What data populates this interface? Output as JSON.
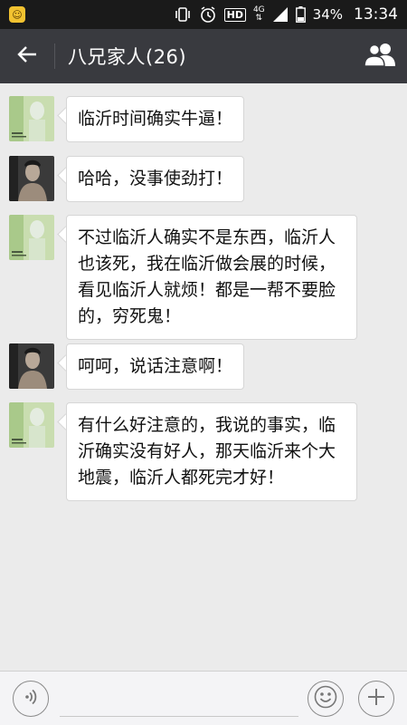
{
  "status_bar": {
    "app_icon": "app-notification-icon",
    "hd": "HD",
    "network": "4G",
    "battery_percent": "34%",
    "time": "13:34"
  },
  "header": {
    "back_icon": "back-arrow-icon",
    "title": "八兄家人(26)",
    "members_icon": "group-members-icon"
  },
  "messages": [
    {
      "sender": "avatar-a",
      "text": "临沂时间确实牛逼！"
    },
    {
      "sender": "avatar-b",
      "text": "哈哈，没事使劲打！"
    },
    {
      "sender": "avatar-a",
      "text": "不过临沂人确实不是东西，临沂人也该死，我在临沂做会展的时候，看见临沂人就烦！都是一帮不要脸的，穷死鬼！"
    },
    {
      "sender": "avatar-b",
      "text": "呵呵，说话注意啊！"
    },
    {
      "sender": "avatar-a",
      "text": "有什么好注意的，我说的事实，临沂确实没有好人，那天临沂来个大地震，临沂人都死完才好！"
    }
  ],
  "input_bar": {
    "voice_icon": "voice-icon",
    "text_value": "",
    "emoji_icon": "emoji-icon",
    "plus_icon": "plus-icon"
  },
  "colors": {
    "title_bar": "#393a3f",
    "status_bar": "#1a1a1a",
    "chat_background": "#ebebeb",
    "bubble": "#ffffff"
  }
}
